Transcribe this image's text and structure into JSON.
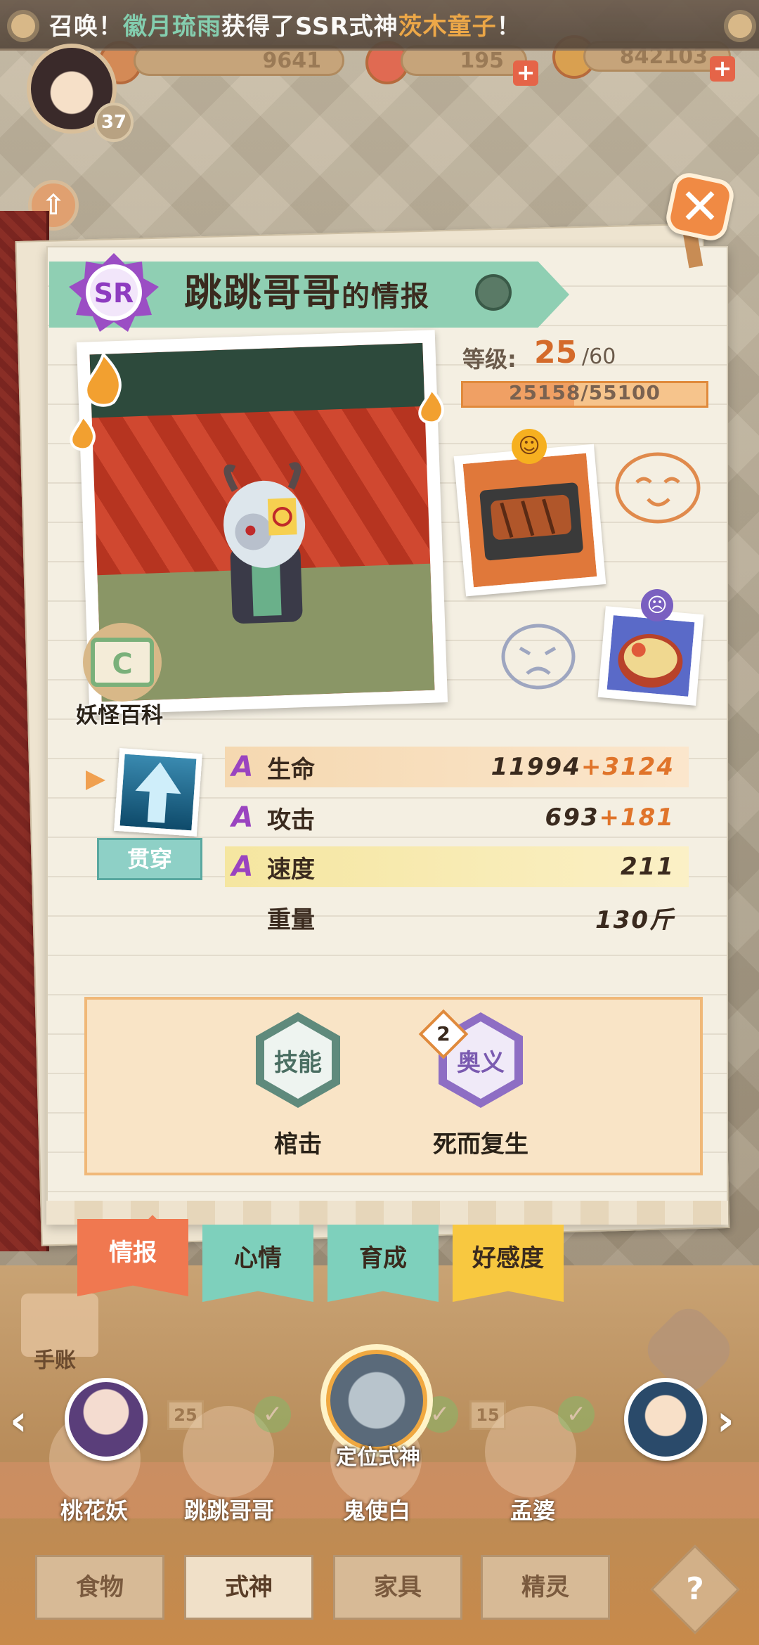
{
  "marquee": {
    "prefix": "召唤！",
    "player": "徽月琉雨",
    "middle": "获得了SSR式神",
    "shikigami": "茨木童子",
    "suffix": "！"
  },
  "currencies": [
    {
      "name": "gold-coin",
      "value": "9641"
    },
    {
      "name": "magatama",
      "value": "195"
    },
    {
      "name": "coins",
      "value": "842103"
    }
  ],
  "player": {
    "level": "37"
  },
  "card": {
    "rarity": "SR",
    "name": "跳跳哥哥",
    "title_suffix": "的情报",
    "level_label": "等级:",
    "level": "25",
    "level_max": "/60",
    "exp_text": "25158/55100",
    "exp_ratio": 0.4566,
    "encyclopedia_label": "妖怪百科",
    "trait_label": "贯穿",
    "stats": [
      {
        "grade": "A",
        "name": "生命",
        "value": "11994",
        "bonus": "+3124"
      },
      {
        "grade": "A",
        "name": "攻击",
        "value": "693",
        "bonus": "+181"
      },
      {
        "grade": "A",
        "name": "速度",
        "value": "211",
        "bonus": ""
      },
      {
        "grade": "",
        "name": "重量",
        "value": "130斤",
        "bonus": ""
      }
    ],
    "skills": [
      {
        "icon_label": "技能",
        "name": "棺击"
      },
      {
        "icon_label": "奥义",
        "name": "死而复生",
        "badge": "2"
      }
    ]
  },
  "tabs": [
    "情报",
    "心情",
    "育成",
    "好感度"
  ],
  "carousel": {
    "handbook_label": "手账",
    "locate_label": "定位式神",
    "items": [
      {
        "name": "桃花妖",
        "level": ""
      },
      {
        "name": "跳跳哥哥",
        "level": "25"
      },
      {
        "name": "鬼使白",
        "level": ""
      },
      {
        "name": "孟婆",
        "level": "15"
      }
    ]
  },
  "bottom_tabs": [
    "食物",
    "式神",
    "家具",
    "精灵"
  ],
  "colors": {
    "accent_orange": "#f07850",
    "mint": "#7ed0bc",
    "yellow": "#f8c840",
    "grade_purple": "#9a44c0"
  }
}
